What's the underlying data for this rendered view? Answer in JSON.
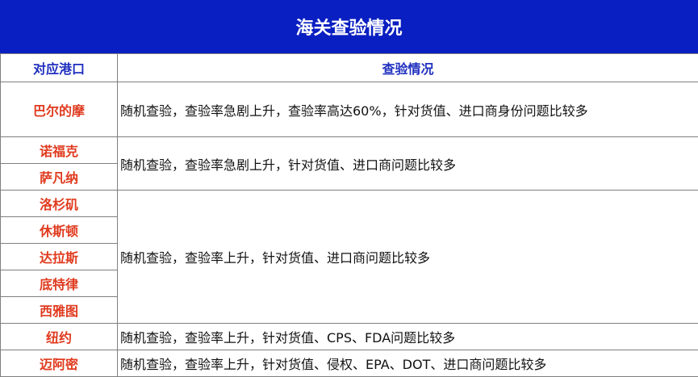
{
  "title": "海关查验情况",
  "headers": {
    "port": "对应港口",
    "status": "查验情况"
  },
  "rows": [
    {
      "port": "巴尔的摩",
      "desc": "随机查验，查验率急剧上升，查验率高达60%，针对货值、进口商身份问题比较多"
    },
    {
      "port": "诺福克",
      "desc": "随机查验，查验率急剧上升，针对货值、进口商问题比较多"
    },
    {
      "port": "萨凡纳"
    },
    {
      "port": "洛杉矶",
      "desc": "随机查验，查验率上升，针对货值、进口商问题比较多"
    },
    {
      "port": "休斯顿"
    },
    {
      "port": "达拉斯"
    },
    {
      "port": "底特律"
    },
    {
      "port": "西雅图"
    },
    {
      "port": "纽约",
      "desc": "随机查验，查验率上升，针对货值、CPS、FDA问题比较多"
    },
    {
      "port": "迈阿密",
      "desc": "随机查验，查验率上升，针对货值、侵权、EPA、DOT、进口商问题比较多"
    }
  ]
}
